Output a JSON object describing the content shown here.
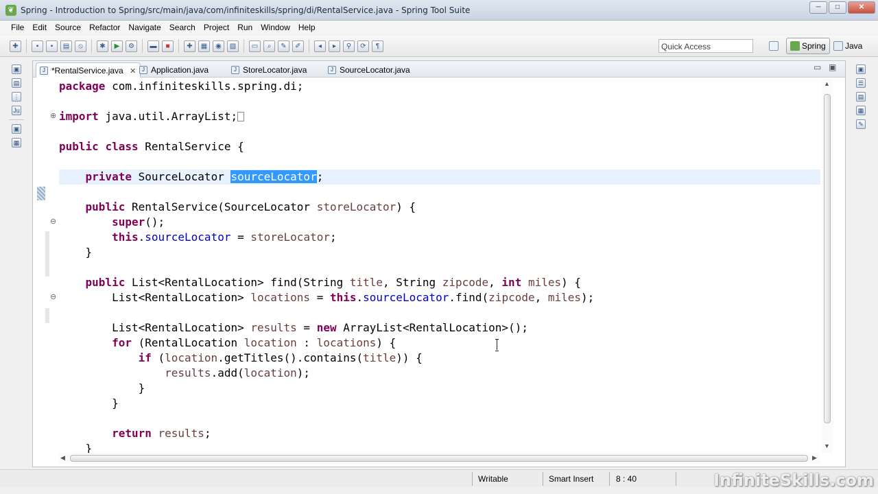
{
  "window": {
    "title": "Spring - Introduction to Spring/src/main/java/com/infiniteskills/spring/di/RentalService.java - Spring Tool Suite",
    "controls": [
      "─",
      "□",
      "✕"
    ]
  },
  "menu": [
    "File",
    "Edit",
    "Source",
    "Refactor",
    "Navigate",
    "Search",
    "Project",
    "Run",
    "Window",
    "Help"
  ],
  "toolbar": {
    "quick_access_placeholder": "Quick Access",
    "perspectives": [
      "Spring",
      "Java"
    ],
    "active_perspective": "Spring"
  },
  "editor": {
    "tabs": [
      {
        "label": "*RentalService.java",
        "active": true,
        "close": "✕"
      },
      {
        "label": "Application.java",
        "active": false
      },
      {
        "label": "StoreLocator.java",
        "active": false
      },
      {
        "label": "SourceLocator.java",
        "active": false
      }
    ],
    "panel_controls": {
      "minimize": "▭",
      "maximize": "▣"
    },
    "fold_markers": {
      "collapsed": "⊕",
      "expanded": "⊖"
    }
  },
  "code": {
    "line1": {
      "kw": "package",
      "rest": " com.infiniteskills.spring.di;"
    },
    "line2": {
      "kw": "import",
      "rest": " java.util.ArrayList;"
    },
    "line3": {
      "kw1": "public",
      "kw2": "class",
      "rest": " RentalService {"
    },
    "line4": {
      "kw": "private",
      "type": " SourceLocator ",
      "field": "sourceLocator",
      "end": ";"
    },
    "line5": {
      "kw": "public",
      "sig": " RentalService(SourceLocator ",
      "param": "storeLocator",
      "end": ") {"
    },
    "line6": {
      "kw": "super",
      "end": "();"
    },
    "line7": {
      "kw": "this",
      "dot": ".",
      "field": "sourceLocator",
      "eq": " = ",
      "param": "storeLocator",
      "end": ";"
    },
    "line8": {
      "text": "}"
    },
    "line9": {
      "kw": "public",
      "p1": " List<RentalLocation> find(String ",
      "a1": "title",
      "p2": ", String ",
      "a2": "zipcode",
      "p3": ", ",
      "kw2": "int",
      "p4": " ",
      "a3": "miles",
      "end": ") {"
    },
    "line10": {
      "t1": "List<RentalLocation> ",
      "v1": "locations",
      "t2": " = ",
      "kw": "this",
      "dot": ".",
      "field": "sourceLocator",
      "t3": ".find(",
      "a1": "zipcode",
      "t4": ", ",
      "a2": "miles",
      "end": ");"
    },
    "line11": {
      "t1": "List<RentalLocation> ",
      "v1": "results",
      "t2": " = ",
      "kw": "new",
      "end": " ArrayList<RentalLocation>();"
    },
    "line12": {
      "kw": "for",
      "t1": " (RentalLocation ",
      "v1": "location",
      "t2": " : ",
      "v2": "locations",
      "end": ") {"
    },
    "line13": {
      "kw": "if",
      "t1": " (",
      "v1": "location",
      "t2": ".getTitles().contains(",
      "v2": "title",
      "end": ")) {"
    },
    "line14": {
      "v1": "results",
      "t1": ".add(",
      "v2": "location",
      "end": ");"
    },
    "line15": {
      "text": "}"
    },
    "line16": {
      "text": "}"
    },
    "line17": {
      "kw": "return",
      "t1": " ",
      "v1": "results",
      "end": ";"
    },
    "line18": {
      "text": "}"
    }
  },
  "status": {
    "mode": "Writable",
    "insert": "Smart Insert",
    "position": "8 : 40"
  },
  "watermark": "InfiniteSkills.com"
}
